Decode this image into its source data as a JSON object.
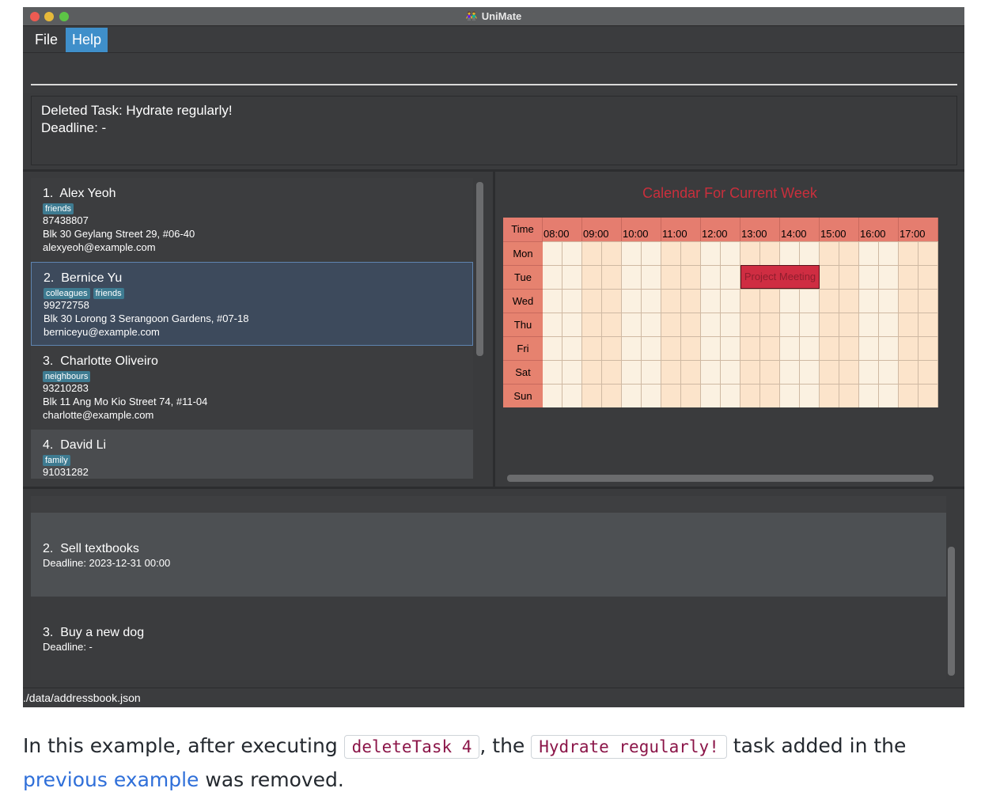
{
  "window": {
    "title": "UniMate",
    "title_icon": "people-icon"
  },
  "menu": {
    "file": "File",
    "help": "Help"
  },
  "command_box": {
    "value": ""
  },
  "result": {
    "line1": "Deleted Task: Hydrate regularly!",
    "line2": "Deadline: -"
  },
  "persons": [
    {
      "index": "1.",
      "name": "Alex Yeoh",
      "tags": [
        "friends"
      ],
      "phone": "87438807",
      "address": "Blk 30 Geylang Street 29, #06-40",
      "email": "alexyeoh@example.com"
    },
    {
      "index": "2.",
      "name": "Bernice Yu",
      "tags": [
        "colleagues",
        "friends"
      ],
      "phone": "99272758",
      "address": "Blk 30 Lorong 3 Serangoon Gardens, #07-18",
      "email": "berniceyu@example.com"
    },
    {
      "index": "3.",
      "name": "Charlotte Oliveiro",
      "tags": [
        "neighbours"
      ],
      "phone": "93210283",
      "address": "Blk 11 Ang Mo Kio Street 74, #11-04",
      "email": "charlotte@example.com"
    },
    {
      "index": "4.",
      "name": "David Li",
      "tags": [
        "family"
      ],
      "phone": "91031282",
      "address": "",
      "email": ""
    }
  ],
  "calendar": {
    "title": "Calendar For Current Week",
    "header_label": "Time",
    "hours": [
      "08:00",
      "09:00",
      "10:00",
      "11:00",
      "12:00",
      "13:00",
      "14:00",
      "15:00",
      "16:00",
      "17:00"
    ],
    "days": [
      "Mon",
      "Tue",
      "Wed",
      "Thu",
      "Fri",
      "Sat",
      "Sun"
    ],
    "events": [
      {
        "label": "Project Meeting",
        "day": "Tue",
        "start": "13:00",
        "end": "15:00"
      }
    ],
    "colors": {
      "header": "#e57d6f",
      "cell_a": "#fce4cb",
      "cell_b": "#fbf1e1",
      "event": "#cf2d42",
      "title": "#c92f3c"
    }
  },
  "tasks": [
    {
      "index": "2.",
      "name": "Sell textbooks",
      "deadline": "Deadline: 2023-12-31 00:00"
    },
    {
      "index": "3.",
      "name": "Buy a new dog",
      "deadline": "Deadline: -"
    }
  ],
  "status": {
    "path": "./data/addressbook.json"
  },
  "caption": {
    "text_before": "In this example, after executing ",
    "code1": "deleteTask 4",
    "text_middle": ", the ",
    "code2": "Hydrate regularly!",
    "text_after_1": " task added in the",
    "link": "previous example",
    "text_after_2": " was removed."
  }
}
